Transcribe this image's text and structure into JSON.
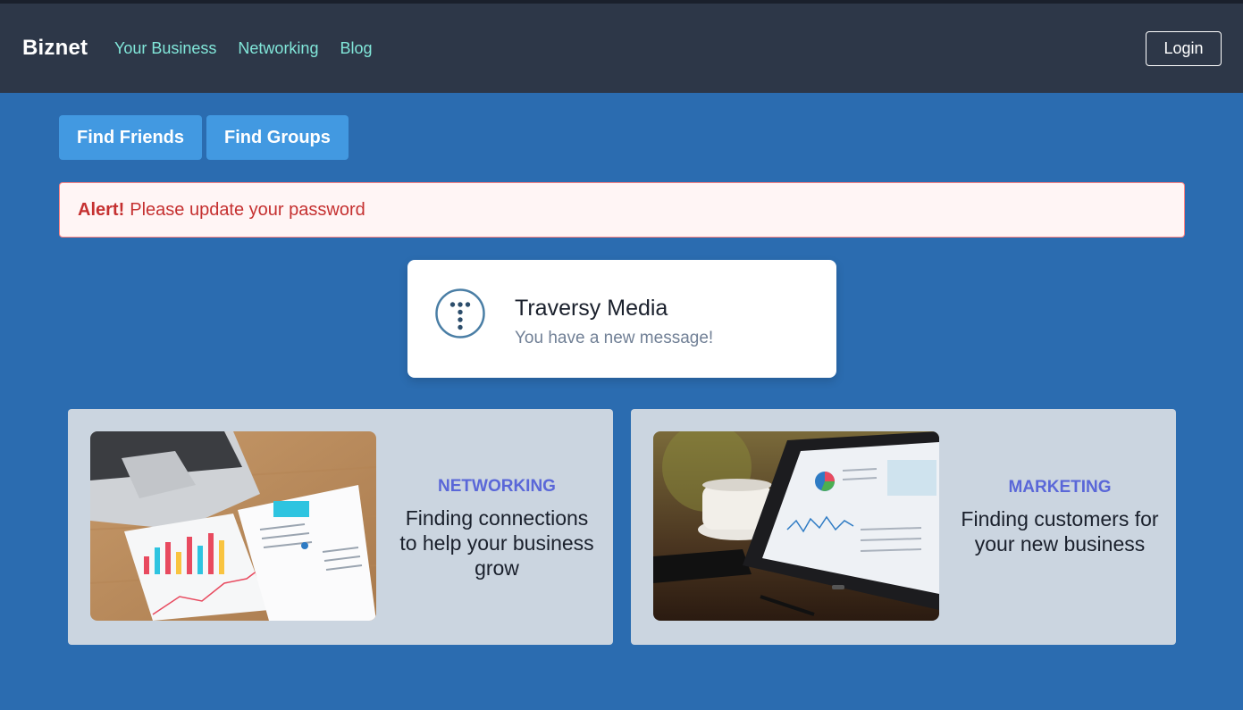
{
  "navbar": {
    "brand": "Biznet",
    "links": [
      "Your Business",
      "Networking",
      "Blog"
    ],
    "login_label": "Login"
  },
  "actions": {
    "find_friends": "Find Friends",
    "find_groups": "Find Groups"
  },
  "alert": {
    "strong": "Alert!",
    "text": "Please update your password"
  },
  "message": {
    "icon": "traversy-logo-icon",
    "title": "Traversy Media",
    "subtitle": "You have a new message!"
  },
  "features": [
    {
      "category": "Networking",
      "description": "Finding connections to help your business grow",
      "image": "printed-charts-on-desk-image"
    },
    {
      "category": "Marketing",
      "description": "Finding customers for your new business",
      "image": "tablet-analytics-dashboard-image"
    }
  ],
  "colors": {
    "page_bg": "#2b6cb0",
    "navbar_bg": "#2d3748",
    "nav_link": "#81e6d9",
    "button_bg": "#4299e1",
    "alert_bg": "#fff5f5",
    "alert_text": "#c53030",
    "card_bg": "#cbd5e0",
    "category_text": "#5a67d8"
  }
}
